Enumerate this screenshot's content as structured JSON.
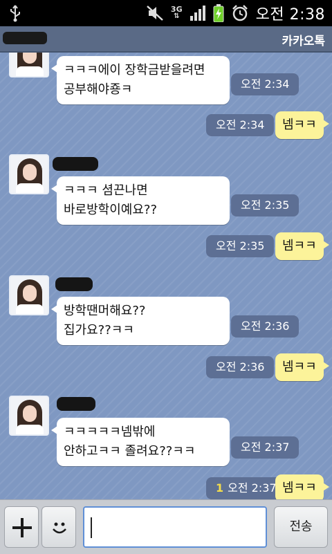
{
  "status_bar": {
    "time": "오전 2:38",
    "network": "3G",
    "icons": [
      "usb-icon",
      "mute-icon",
      "network-3g-icon",
      "signal-icon",
      "battery-charging-icon",
      "alarm-icon"
    ]
  },
  "title_bar": {
    "app_name": "카카오톡"
  },
  "messages": [
    {
      "direction": "in",
      "lines": [
        "ㅋㅋㅋ에이 장학금받을려면",
        "공부해야죵ㅋ"
      ],
      "time": "오전 2:34"
    },
    {
      "direction": "out",
      "text": "넴ㅋㅋ",
      "time": "오전 2:34"
    },
    {
      "direction": "in",
      "lines": [
        "ㅋㅋㅋ 셤끈나면",
        "바로방학이예요??"
      ],
      "time": "오전 2:35"
    },
    {
      "direction": "out",
      "text": "넴ㅋㅋ",
      "time": "오전 2:35"
    },
    {
      "direction": "in",
      "lines": [
        "방학땐머해요??",
        "집가요??ㅋㅋ"
      ],
      "time": "오전 2:36"
    },
    {
      "direction": "out",
      "text": "넴ㅋㅋ",
      "time": "오전 2:36"
    },
    {
      "direction": "in",
      "lines": [
        "ㅋㅋㅋㅋㅋ넴밖에",
        "안하고ㅋㅋ 졸려요??ㅋㅋ"
      ],
      "time": "오전 2:37"
    },
    {
      "direction": "out",
      "text": "넴ㅋㅋ",
      "time": "오전 2:37",
      "unread": "1"
    }
  ],
  "input_bar": {
    "send_label": "전송",
    "input_value": "",
    "icons": [
      "plus-icon",
      "emoticon-icon"
    ]
  },
  "colors": {
    "chat_background": "#7f98c2",
    "outgoing_bubble": "#fcf39a",
    "incoming_bubble": "#ffffff",
    "time_pill": "#5d6f94",
    "title_bar": "#5a6a86",
    "unread_count": "#f4dd4c"
  }
}
